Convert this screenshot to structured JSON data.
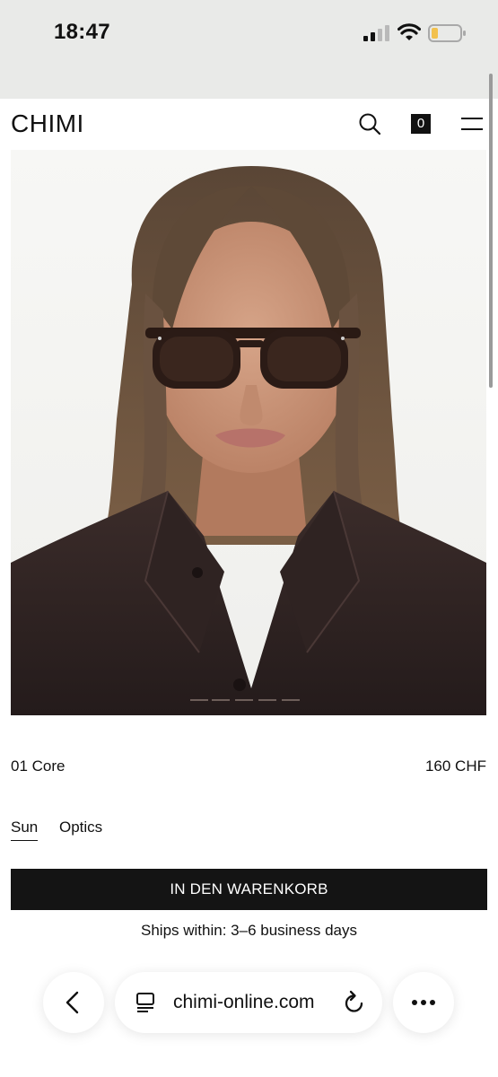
{
  "status_bar": {
    "time": "18:47",
    "icons": [
      "cellular-signal-icon",
      "wifi-icon",
      "battery-low-icon"
    ],
    "battery_color": "#f2c14e"
  },
  "header": {
    "logo": "CHIMI",
    "cart_count": "0",
    "icons": [
      "search-icon",
      "hamburger-menu-icon"
    ]
  },
  "product": {
    "image_description_icon": "model-wearing-sunglasses-photo",
    "name": "01 Core",
    "price": "160 CHF",
    "variants": [
      {
        "label": "Sun",
        "selected": true
      },
      {
        "label": "Optics",
        "selected": false
      }
    ],
    "add_to_cart_label": "IN DEN WARENKORB",
    "shipping_text": "Ships within: 3–6 business days"
  },
  "browser": {
    "url": "chimi-online.com",
    "icons": [
      "back-chevron-icon",
      "reader-mode-icon",
      "reload-icon",
      "more-dots-icon"
    ]
  },
  "colors": {
    "status_bar_bg": "#e9eae8",
    "button_bg": "#141414",
    "text": "#111111"
  }
}
